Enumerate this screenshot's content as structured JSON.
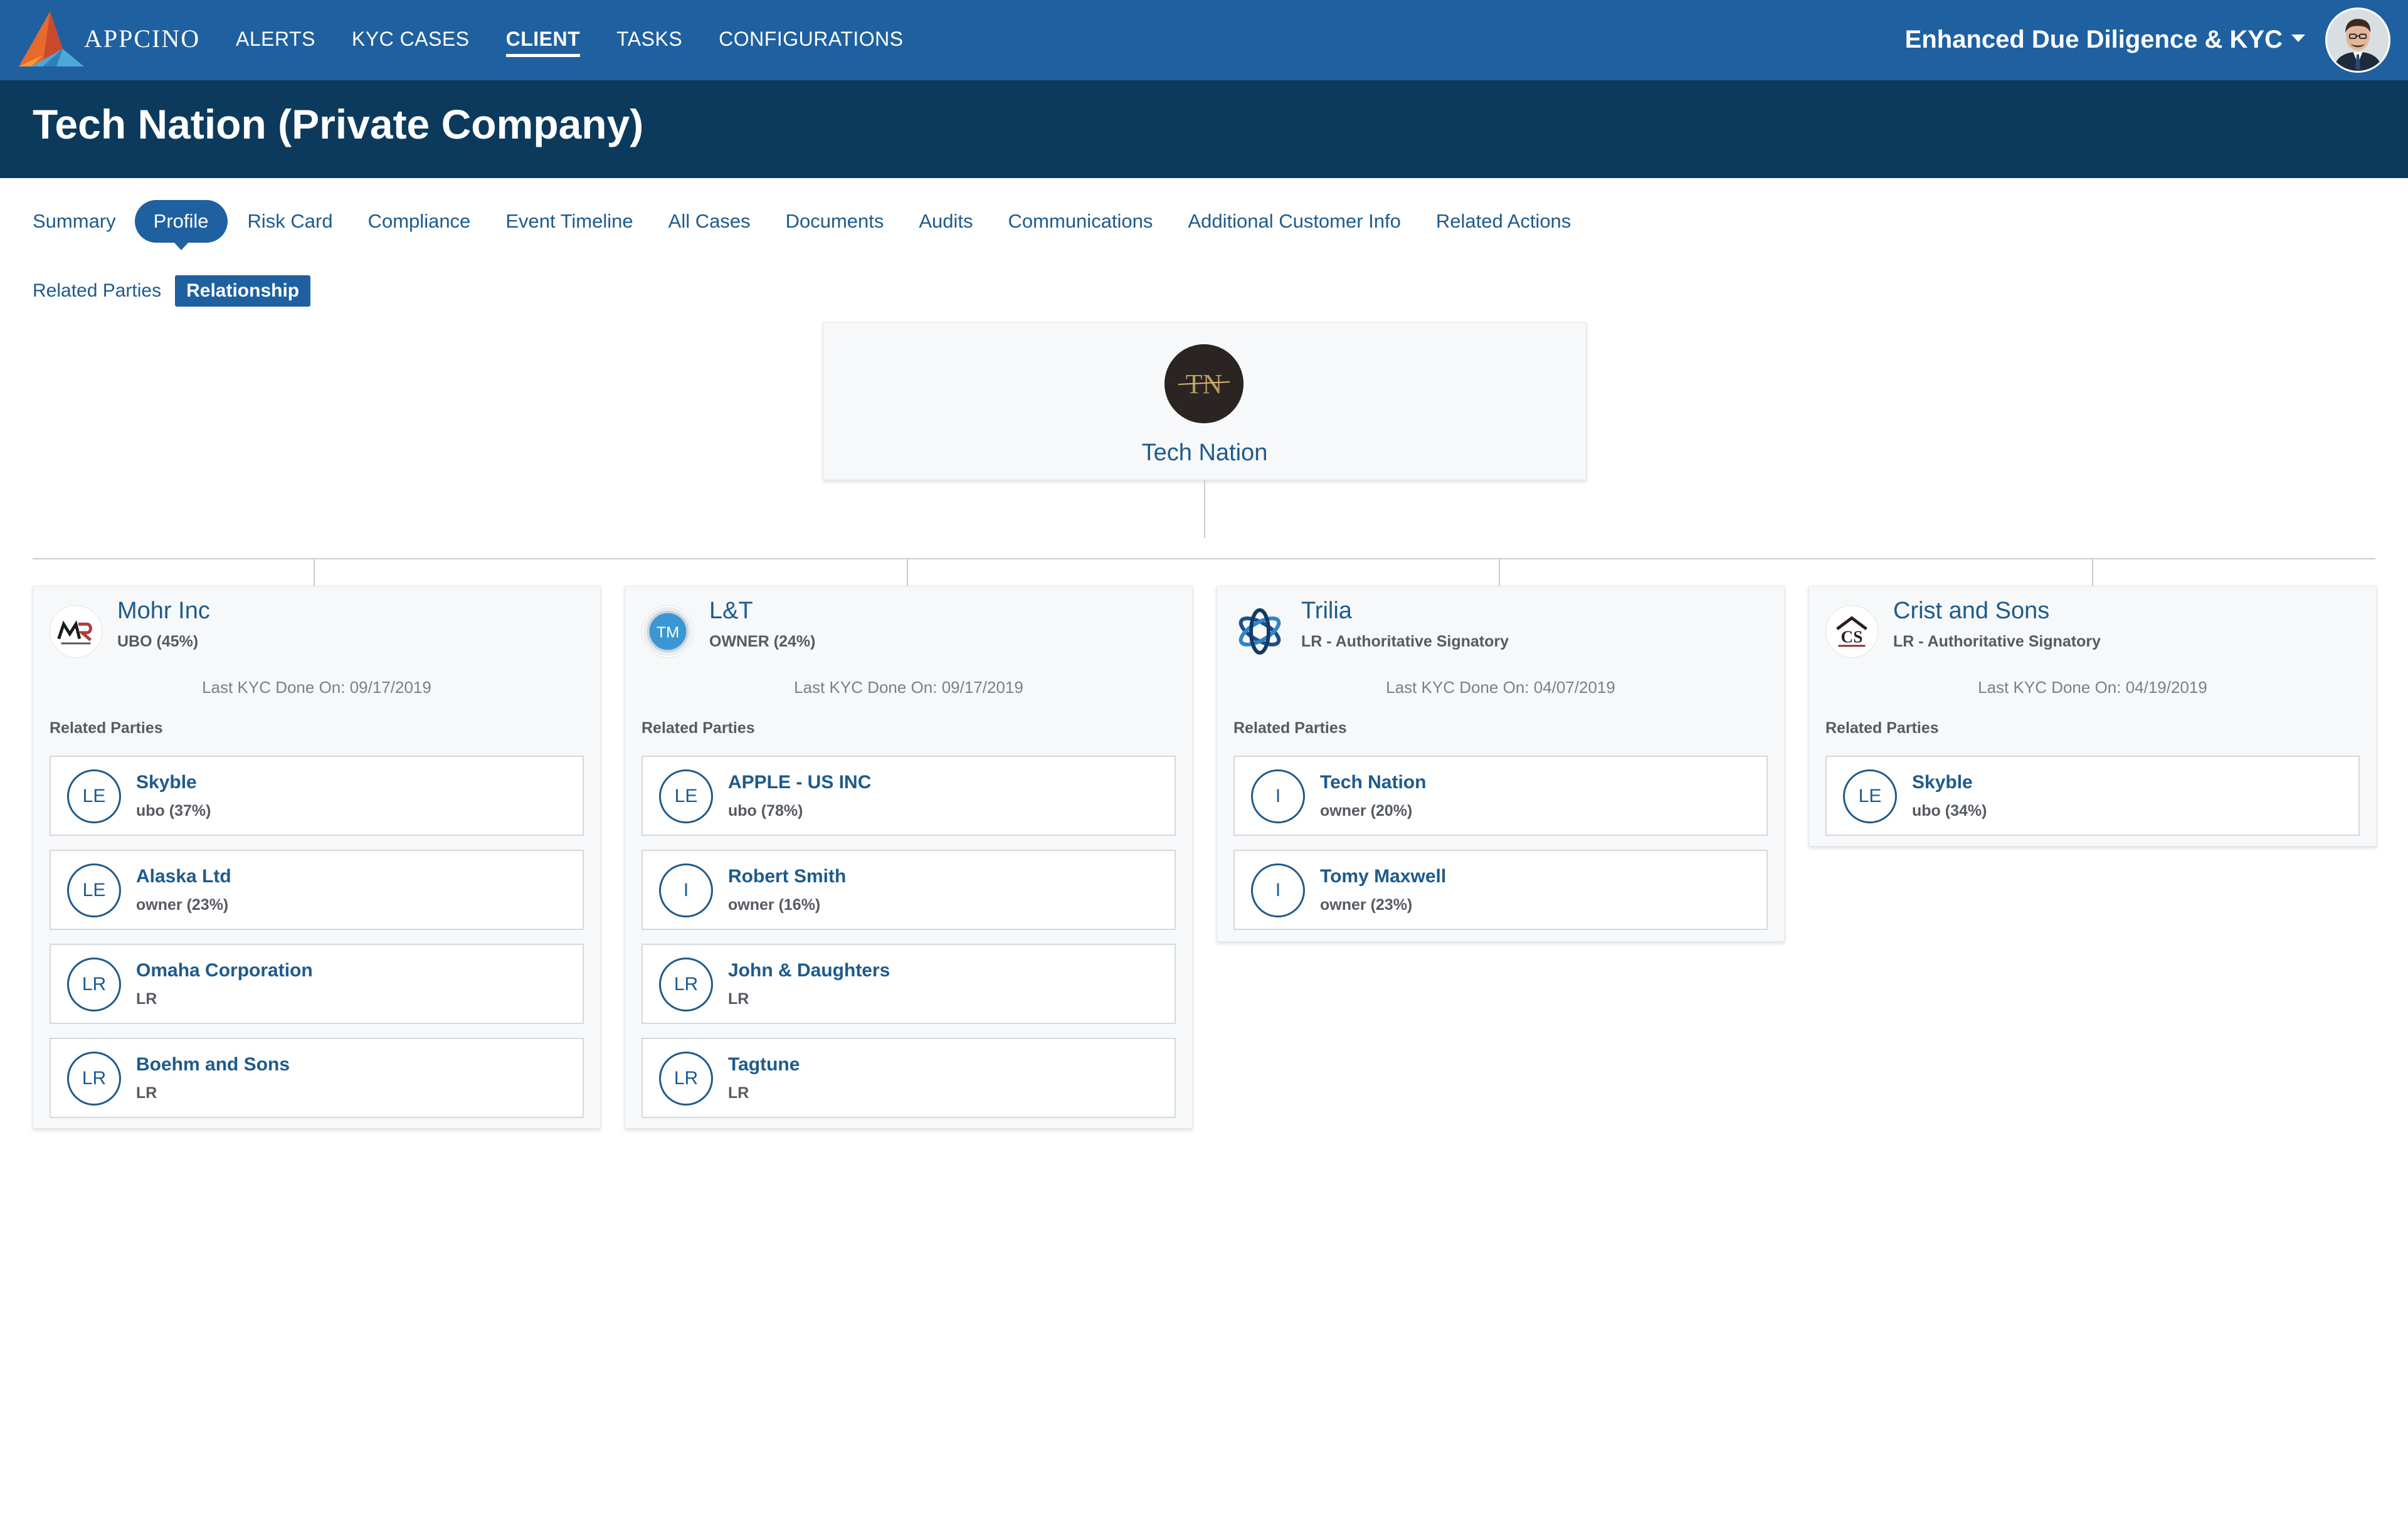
{
  "header": {
    "brand": "APPCINO",
    "nav": [
      {
        "label": "ALERTS",
        "active": false
      },
      {
        "label": "KYC CASES",
        "active": false
      },
      {
        "label": "CLIENT",
        "active": true
      },
      {
        "label": "TASKS",
        "active": false
      },
      {
        "label": "CONFIGURATIONS",
        "active": false
      }
    ],
    "product": "Enhanced Due Diligence & KYC"
  },
  "page": {
    "title": "Tech Nation (Private Company)"
  },
  "tabs": [
    {
      "label": "Summary",
      "active": false
    },
    {
      "label": "Profile",
      "active": true
    },
    {
      "label": "Risk Card",
      "active": false
    },
    {
      "label": "Compliance",
      "active": false
    },
    {
      "label": "Event Timeline",
      "active": false
    },
    {
      "label": "All Cases",
      "active": false
    },
    {
      "label": "Documents",
      "active": false
    },
    {
      "label": "Audits",
      "active": false
    },
    {
      "label": "Communications",
      "active": false
    },
    {
      "label": "Additional Customer Info",
      "active": false
    },
    {
      "label": "Related Actions",
      "active": false
    }
  ],
  "subtabs": [
    {
      "label": "Related Parties",
      "active": false
    },
    {
      "label": "Relationship",
      "active": true
    }
  ],
  "root": {
    "name": "Tech Nation",
    "logo_text": "TN"
  },
  "colors": {
    "nav_bg": "#1e60a0",
    "title_bg": "#0b3a5c",
    "accent": "#1f5a8c"
  },
  "entities": [
    {
      "name": "Mohr Inc",
      "role": "UBO (45%)",
      "kyc": "Last KYC Done On: 09/17/2019",
      "related_label": "Related Parties",
      "logo": "mr-logo-icon",
      "related": [
        {
          "badge": "LE",
          "name": "Skyble",
          "relation": "ubo (37%)"
        },
        {
          "badge": "LE",
          "name": "Alaska Ltd",
          "relation": "owner (23%)"
        },
        {
          "badge": "LR",
          "name": "Omaha Corporation",
          "relation": "LR"
        },
        {
          "badge": "LR",
          "name": "Boehm and Sons",
          "relation": "LR"
        }
      ]
    },
    {
      "name": "L&T",
      "role": "OWNER (24%)",
      "kyc": "Last KYC Done On: 09/17/2019",
      "related_label": "Related Parties",
      "logo": "tm-logo-icon",
      "related": [
        {
          "badge": "LE",
          "name": "APPLE - US INC",
          "relation": "ubo (78%)"
        },
        {
          "badge": "I",
          "name": "Robert Smith",
          "relation": "owner (16%)"
        },
        {
          "badge": "LR",
          "name": "John & Daughters",
          "relation": "LR"
        },
        {
          "badge": "LR",
          "name": "Tagtune",
          "relation": "LR"
        }
      ]
    },
    {
      "name": "Trilia",
      "role": "LR - Authoritative Signatory",
      "kyc": "Last KYC Done On: 04/07/2019",
      "related_label": "Related Parties",
      "logo": "rings-logo-icon",
      "related": [
        {
          "badge": "I",
          "name": "Tech Nation",
          "relation": "owner (20%)"
        },
        {
          "badge": "I",
          "name": "Tomy Maxwell",
          "relation": "owner (23%)"
        }
      ]
    },
    {
      "name": "Crist and Sons",
      "role": "LR - Authoritative Signatory",
      "kyc": "Last KYC Done On: 04/19/2019",
      "related_label": "Related Parties",
      "logo": "cs-house-logo-icon",
      "related": [
        {
          "badge": "LE",
          "name": "Skyble",
          "relation": "ubo (34%)"
        }
      ]
    }
  ]
}
